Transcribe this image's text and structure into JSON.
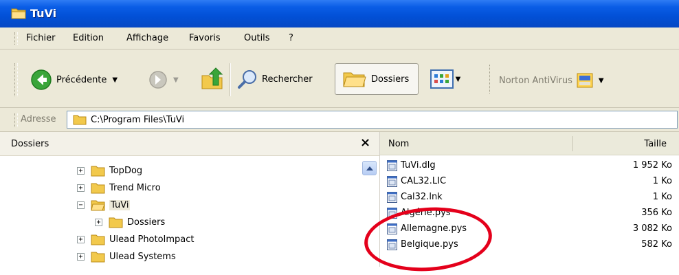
{
  "window": {
    "title": "TuVi"
  },
  "menu": [
    "Fichier",
    "Edition",
    "Affichage",
    "Favoris",
    "Outils",
    "?"
  ],
  "toolbar": {
    "back_label": "Précédente",
    "search_label": "Rechercher",
    "folders_label": "Dossiers",
    "norton_label": "Norton AntiVirus"
  },
  "address": {
    "label": "Adresse",
    "path": "C:\\Program Files\\TuVi"
  },
  "folders_pane": {
    "title": "Dossiers",
    "tree": [
      {
        "label": "TopDog",
        "expander": "+"
      },
      {
        "label": "Trend Micro",
        "expander": "+"
      },
      {
        "label": "TuVi",
        "expander": "−",
        "selected": true
      },
      {
        "label": "Dossiers",
        "expander": "+"
      },
      {
        "label": "Ulead PhotoImpact",
        "expander": "+"
      },
      {
        "label": "Ulead Systems",
        "expander": "+"
      }
    ]
  },
  "files_pane": {
    "columns": {
      "name": "Nom",
      "size": "Taille"
    },
    "files": [
      {
        "name": "TuVi.dlg",
        "size": "1 952 Ko"
      },
      {
        "name": "CAL32.LIC",
        "size": "1 Ko"
      },
      {
        "name": "Cal32.lnk",
        "size": "1 Ko"
      },
      {
        "name": "Algérie.pys",
        "size": "356 Ko"
      },
      {
        "name": "Allemagne.pys",
        "size": "3 082 Ko"
      },
      {
        "name": "Belgique.pys",
        "size": "582 Ko"
      }
    ]
  },
  "colors": {
    "titlebar": "#0250d6",
    "highlight_circle": "#e4001b",
    "folder": "#f2c94c",
    "back_button": "#3aa53a",
    "chrome": "#ece9d8"
  }
}
